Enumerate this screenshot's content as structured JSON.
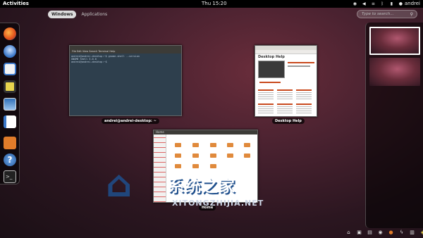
{
  "top_panel": {
    "activities_label": "Activities",
    "clock": "Thu 15:20",
    "user_name": "andrei"
  },
  "view_selector": {
    "windows_label": "Windows",
    "applications_label": "Applications"
  },
  "search": {
    "placeholder": "Type to search..."
  },
  "dash": {
    "items": [
      {
        "icon": "firefox-icon"
      },
      {
        "icon": "thunderbird-icon"
      },
      {
        "icon": "empathy-icon"
      },
      {
        "icon": "rhythmbox-icon"
      },
      {
        "icon": "shotwell-icon"
      },
      {
        "icon": "writer-icon"
      },
      {
        "icon": "software-center-icon"
      },
      {
        "icon": "help-icon"
      },
      {
        "icon": "terminal-icon"
      }
    ]
  },
  "windows": {
    "terminal": {
      "caption": "andrei@andrei-desktop: ~",
      "menu": "File  Edit  View  Search  Terminal  Help",
      "line1": "andrei@andrei-desktop:~$ gnome-shell --version",
      "line2": "GNOME Shell 3.0.0",
      "line3": "andrei@andrei-desktop:~$ "
    },
    "help": {
      "caption": "Desktop Help",
      "heading": "Desktop Help"
    },
    "files": {
      "caption": "Home",
      "title": "Home"
    }
  },
  "watermark": {
    "text": "系统之家",
    "url": "XITONGZHIJIA.NET"
  }
}
